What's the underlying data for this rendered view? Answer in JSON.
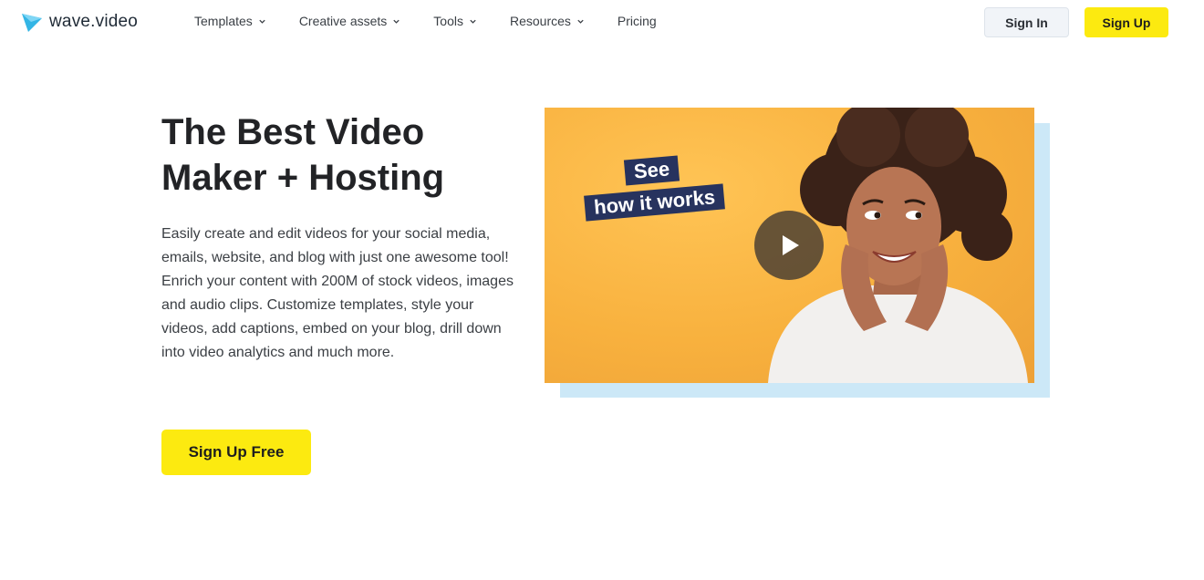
{
  "brand": {
    "name": "wave.video",
    "accent": "#fcea10",
    "logo_color": "#33b5e5"
  },
  "nav": {
    "items": [
      {
        "label": "Templates",
        "has_dropdown": true
      },
      {
        "label": "Creative assets",
        "has_dropdown": true
      },
      {
        "label": "Tools",
        "has_dropdown": true
      },
      {
        "label": "Resources",
        "has_dropdown": true
      },
      {
        "label": "Pricing",
        "has_dropdown": false
      }
    ]
  },
  "header": {
    "signin_label": "Sign In",
    "signup_label": "Sign Up"
  },
  "hero": {
    "title_line1": "The Best Video",
    "title_line2": "Maker + Hosting",
    "description_1": "Easily create and edit videos for your social media, emails, website, and blog with just one awesome tool!",
    "description_2": "Enrich your content with 200M of stock videos, images and audio clips. Customize templates, style your videos, add captions, embed on your blog, drill down into video analytics and much more.",
    "cta_label": "Sign Up Free"
  },
  "video": {
    "see_text": "See",
    "how_text": "how it works",
    "play_icon": "play-icon",
    "label_color": "#27335e",
    "bg_color": "#f8b13e",
    "shadow_color": "#cce8f7"
  }
}
